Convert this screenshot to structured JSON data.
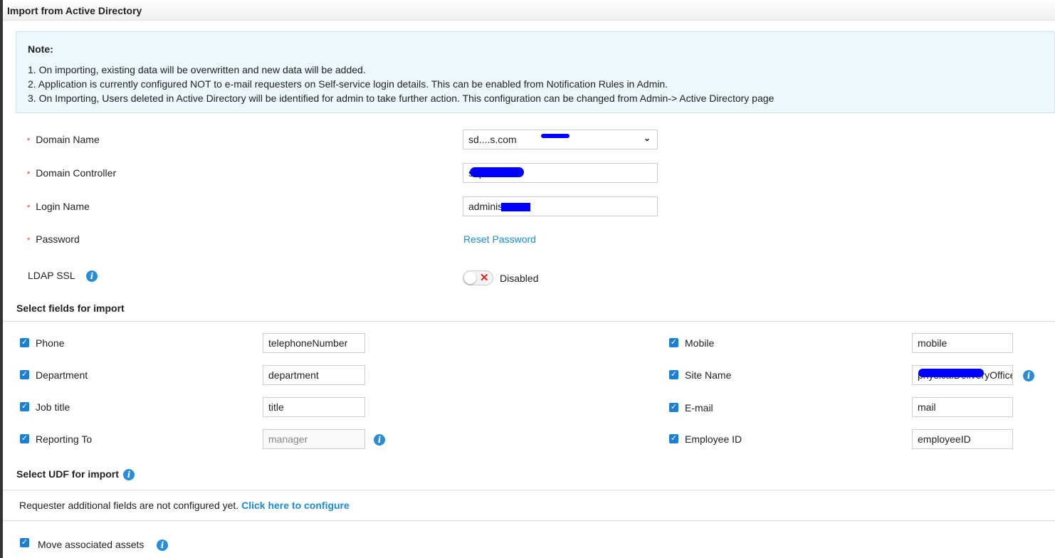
{
  "header": {
    "title": "Import from Active Directory"
  },
  "note": {
    "title": "Note:",
    "lines": [
      "1. On importing, existing data will be overwritten and new data will be added.",
      "2. Application is currently configured NOT to e-mail requesters on Self-service login details. This can be enabled from Notification Rules in Admin.",
      "3. On Importing, Users deleted in Active Directory will be identified for admin to take further action. This configuration can be changed from Admin-> Active Directory page"
    ]
  },
  "form": {
    "domain_name": {
      "label": "Domain Name",
      "value": "sd....s.com"
    },
    "domain_controller": {
      "label": "Domain Controller",
      "value": "sdp-2k19"
    },
    "login_name": {
      "label": "Login Name",
      "value": "adminis"
    },
    "password": {
      "label": "Password",
      "link": "Reset Password"
    },
    "ldap_ssl": {
      "label": "LDAP SSL",
      "state": "Disabled"
    }
  },
  "fields": {
    "title": "Select fields for import",
    "left": [
      {
        "label": "Phone",
        "value": "telephoneNumber",
        "checked": true
      },
      {
        "label": "Department",
        "value": "department",
        "checked": true
      },
      {
        "label": "Job title",
        "value": "title",
        "checked": true
      },
      {
        "label": "Reporting To",
        "value": "manager",
        "checked": true
      }
    ],
    "right": [
      {
        "label": "Mobile",
        "value": "mobile",
        "checked": true
      },
      {
        "label": "Site Name",
        "value": "physicalDeliveryOffice",
        "checked": true
      },
      {
        "label": "E-mail",
        "value": "mail",
        "checked": true
      },
      {
        "label": "Employee ID",
        "value": "employeeID",
        "checked": true
      }
    ]
  },
  "udf": {
    "title": "Select UDF for import",
    "message": "Requester additional fields are not configured yet.",
    "link": "Click here to configure"
  },
  "assets": {
    "label": "Move associated assets",
    "checked": true
  },
  "colors": {
    "accent": "#1e7fd0",
    "link": "#1a8ad8",
    "required": "#d9342b"
  }
}
